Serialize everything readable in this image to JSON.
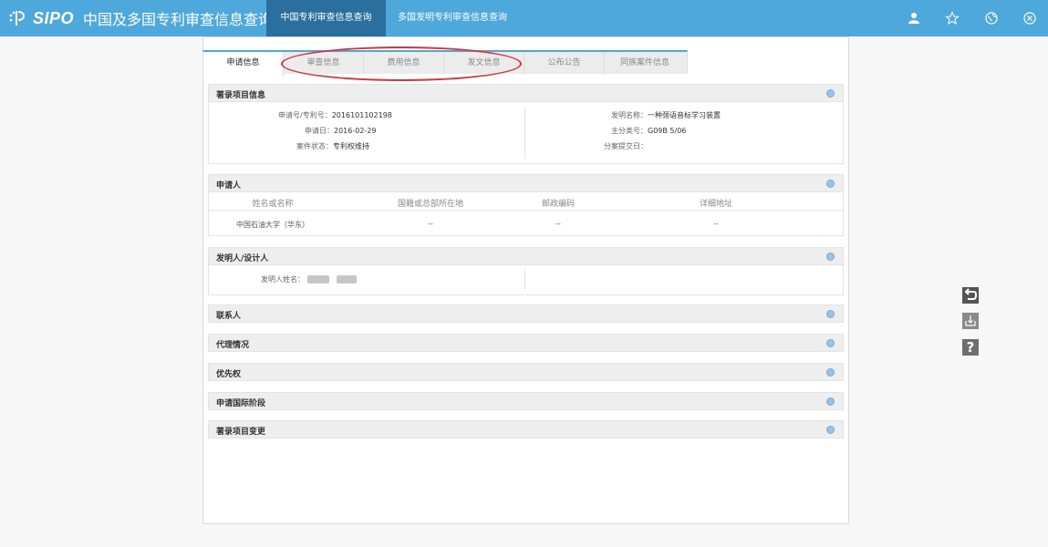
{
  "header": {
    "brand": "SIPO",
    "site_title": "中国及多国专利审查信息查询",
    "nav": [
      "中国专利审查信息查询",
      "多国发明专利审查信息查询"
    ],
    "icons": [
      "user-icon",
      "star-icon",
      "globe-icon",
      "close-icon"
    ]
  },
  "tabs": [
    "申请信息",
    "审查信息",
    "费用信息",
    "发文信息",
    "公布公告",
    "同族案件信息"
  ],
  "bibliographic": {
    "title": "著录项目信息",
    "app_no_label": "申请号/专利号：",
    "app_no": "2016101102198",
    "app_date_label": "申请日：",
    "app_date": "2016-02-29",
    "status_label": "案件状态：",
    "status": "专利权维持",
    "invention_name_label": "发明名称：",
    "invention_name": "一种颈语音标学习装置",
    "main_class_label": "主分类号：",
    "main_class": "G09B 5/06",
    "division_date_label": "分案提交日："
  },
  "applicant": {
    "title": "申请人",
    "columns": [
      "姓名或名称",
      "国籍或总部所在地",
      "邮政编码",
      "详细地址"
    ],
    "row": [
      "中国石油大学（华东）",
      "--",
      "--",
      "--"
    ]
  },
  "inventor": {
    "title": "发明人/设计人",
    "name_label": "发明人姓名："
  },
  "collapsed_sections": [
    "联系人",
    "代理情况",
    "优先权",
    "申请国际阶段",
    "著录项目变更"
  ],
  "tools": [
    "back-icon",
    "download-icon",
    "help-icon"
  ],
  "colors": {
    "header": "#4fa8dc",
    "active_nav": "#2a6f9e",
    "annotation": "#d7323a",
    "section_dot": "#9cc3e4"
  }
}
